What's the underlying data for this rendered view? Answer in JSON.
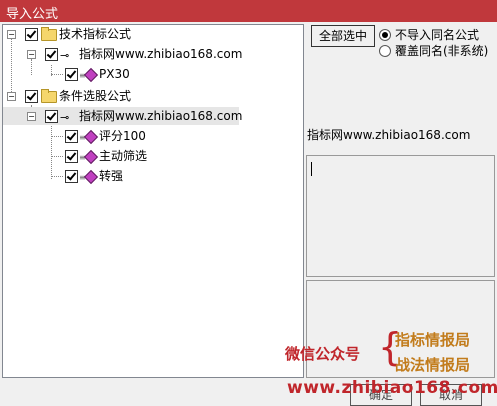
{
  "window": {
    "title": "导入公式"
  },
  "tree": {
    "group1": {
      "label": "技术指标公式",
      "author": "指标网www.zhibiao168.com",
      "items": [
        "PX30"
      ]
    },
    "group2": {
      "label": "条件选股公式",
      "author": "指标网www.zhibiao168.com",
      "items": [
        "评分100",
        "主动筛选",
        "转强"
      ]
    }
  },
  "controls": {
    "select_all": "全部选中",
    "options": [
      "不导入同名公式",
      "覆盖同名(非系统)"
    ],
    "selected_option": 0
  },
  "info": {
    "author": "指标网www.zhibiao168.com"
  },
  "watermark": {
    "wechat": "微信公众号",
    "brand1": "指标情报局",
    "brand2": "战法情报局",
    "url": "www.zhibiao168.com"
  },
  "footer": {
    "ok": "确定",
    "cancel": "取消"
  },
  "colors": {
    "titlebar": "#c0383c",
    "watermark_red": "#c0262b",
    "watermark_orange": "#c27c1c",
    "diamond": "#c040c0"
  }
}
